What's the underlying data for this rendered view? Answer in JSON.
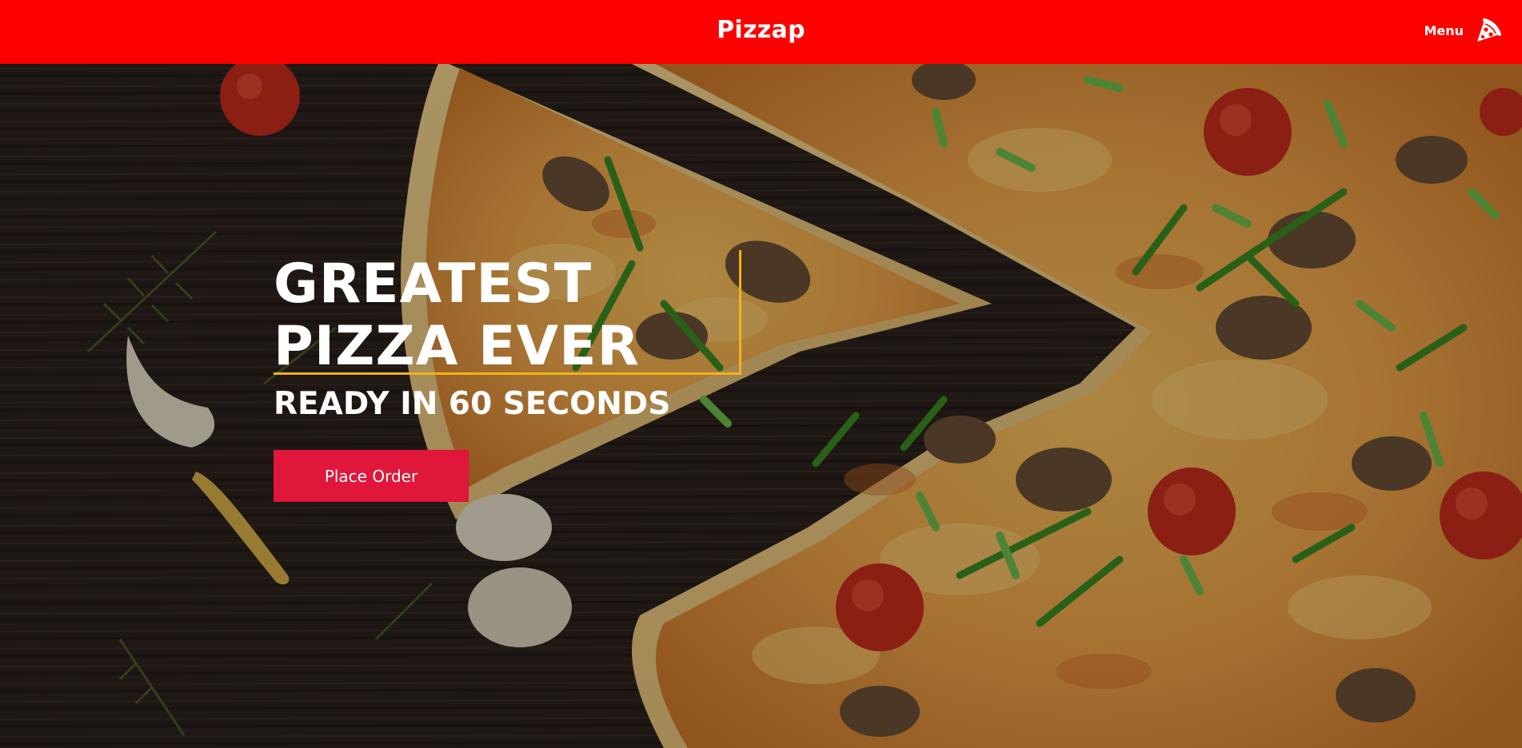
{
  "header": {
    "brand": "Pizzap",
    "menu_label": "Menu",
    "menu_icon": "pizza-slice-icon",
    "background": "#ff0000"
  },
  "hero": {
    "headline_line1": "GREATEST",
    "headline_line2": "PIZZA EVER",
    "subheadline": "READY IN 60 SECONDS",
    "cta_label": "Place Order",
    "cta_color": "#e0163a",
    "accent_color": "#f2b21b",
    "background_image": "pizza-on-wooden-table"
  }
}
